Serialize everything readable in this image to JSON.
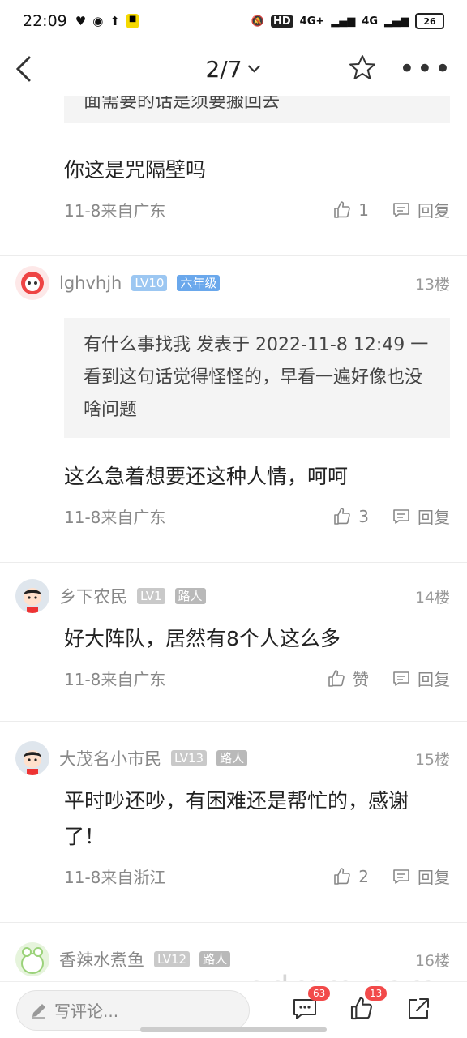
{
  "status_bar": {
    "time": "22:09",
    "network1": "4G+",
    "network2": "4G",
    "hd": "HD",
    "battery": "26"
  },
  "nav": {
    "title": "2/7"
  },
  "posts": [
    {
      "quote": "面需要的话是须要搬回去",
      "text": "你这是咒隔壁吗",
      "meta": "11-8来自广东",
      "likes": "1",
      "reply_label": "回复"
    },
    {
      "username": "lghvhjh",
      "level": "LV10",
      "tag": "六年级",
      "floor": "13楼",
      "quote": "有什么事找我 发表于 2022-11-8 12:49 一看到这句话觉得怪怪的，早看一遍好像也没啥问题",
      "text": "这么急着想要还这种人情，呵呵",
      "meta": "11-8来自广东",
      "likes": "3",
      "reply_label": "回复"
    },
    {
      "username": "乡下农民",
      "level": "LV1",
      "tag": "路人",
      "floor": "14楼",
      "text": "好大阵队，居然有8个人这么多",
      "meta": "11-8来自广东",
      "likes": "赞",
      "reply_label": "回复"
    },
    {
      "username": "大茂名小市民",
      "level": "LV13",
      "tag": "路人",
      "floor": "15楼",
      "text": "平时吵还吵，有困难还是帮忙的，感谢了！",
      "meta": "11-8来自浙江",
      "likes": "2",
      "reply_label": "回复"
    },
    {
      "username": "香辣水煮鱼",
      "level": "LV12",
      "tag": "路人",
      "floor": "16楼"
    }
  ],
  "bottom_bar": {
    "placeholder": "写评论...",
    "comments_count": "63",
    "likes_count": "13"
  },
  "watermark": "gdmm.com"
}
